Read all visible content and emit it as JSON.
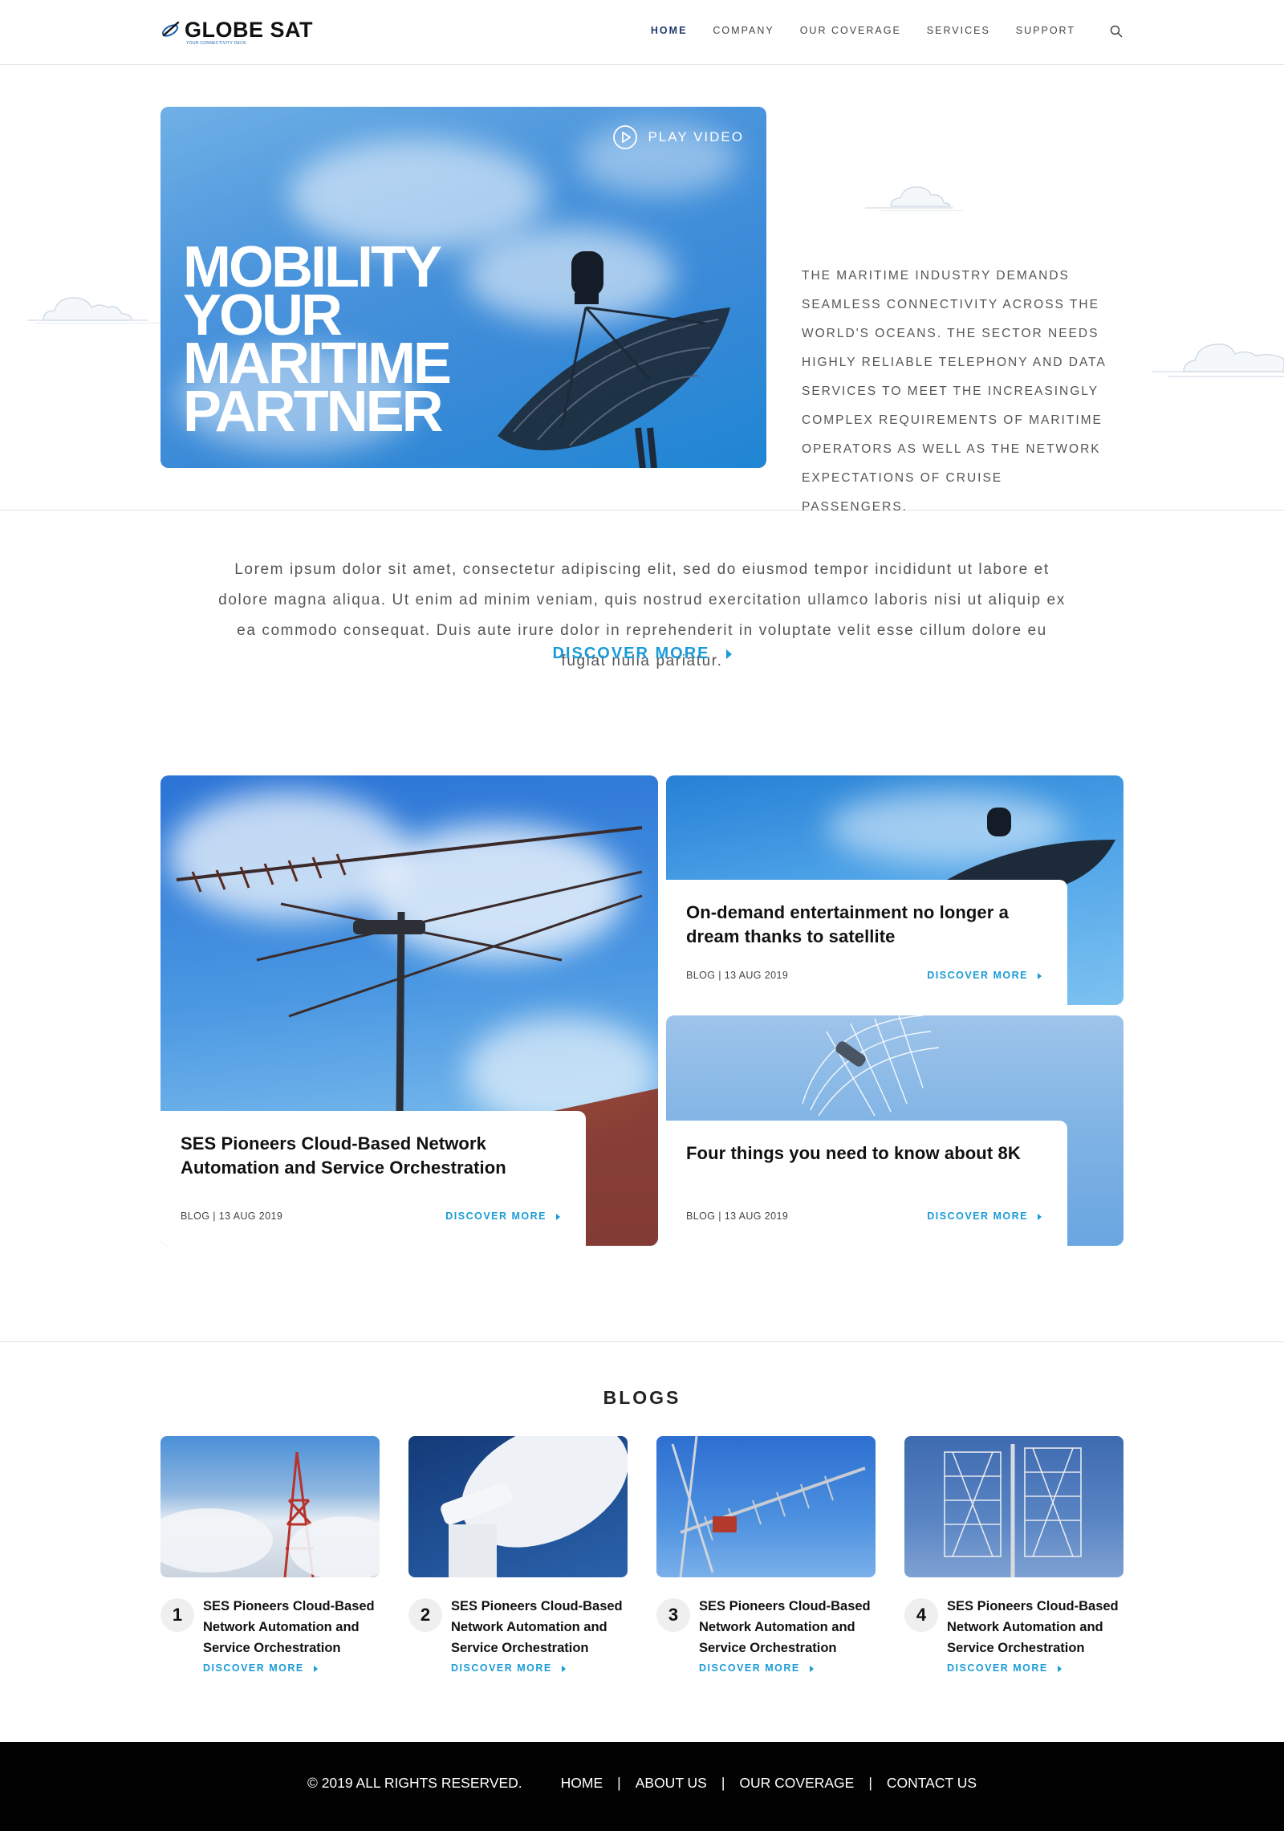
{
  "brand": {
    "name": "GLOBE SAT",
    "tagline": "YOUR CONNECTIVITY DECK"
  },
  "nav": {
    "items": [
      {
        "label": "HOME",
        "active": true
      },
      {
        "label": "COMPANY",
        "active": false
      },
      {
        "label": "OUR COVERAGE",
        "active": false
      },
      {
        "label": "SERVICES",
        "active": false
      },
      {
        "label": "SUPPORT",
        "active": false
      }
    ],
    "search_icon": "search-icon"
  },
  "hero": {
    "title_lines": [
      "MOBILITY",
      "YOUR",
      "MARITIME",
      "PARTNER"
    ],
    "play_label": "PLAY VIDEO",
    "play_icon": "play-circle-icon",
    "description": "THE MARITIME INDUSTRY DEMANDS SEAMLESS CONNECTIVITY ACROSS THE WORLD'S OCEANS. THE SECTOR NEEDS HIGHLY RELIABLE TELEPHONY AND DATA SERVICES TO MEET THE INCREASINGLY COMPLEX REQUIREMENTS OF MARITIME OPERATORS AS WELL AS THE NETWORK EXPECTATIONS OF CRUISE PASSENGERS."
  },
  "intro": {
    "text": "Lorem ipsum dolor sit amet, consectetur adipiscing elit, sed do eiusmod tempor incididunt ut labore et dolore magna aliqua. Ut enim ad minim veniam, quis nostrud exercitation ullamco laboris nisi ut aliquip ex ea commodo consequat. Duis aute irure dolor in reprehenderit in voluptate velit esse cillum dolore eu fugiat nulla pariatur.",
    "cta": "DISCOVER MORE"
  },
  "features": [
    {
      "title": "SES Pioneers Cloud-Based Network Automation and Service Orchestration",
      "meta": "BLOG | 13 AUG 2019",
      "link": "DISCOVER MORE"
    },
    {
      "title": "On-demand entertainment no longer a dream thanks to satellite",
      "meta": "BLOG | 13 AUG 2019",
      "link": "DISCOVER MORE"
    },
    {
      "title": "Four things you need to know about 8K",
      "meta": "BLOG | 13 AUG 2019",
      "link": "DISCOVER MORE"
    }
  ],
  "blogs": {
    "heading": "BLOGS",
    "items": [
      {
        "num": "1",
        "title": "SES Pioneers Cloud-Based Network Automation and Service Orchestration",
        "link": "DISCOVER MORE"
      },
      {
        "num": "2",
        "title": "SES Pioneers Cloud-Based Network Automation and Service Orchestration",
        "link": "DISCOVER MORE"
      },
      {
        "num": "3",
        "title": "SES Pioneers Cloud-Based Network Automation and Service Orchestration",
        "link": "DISCOVER MORE"
      },
      {
        "num": "4",
        "title": "SES Pioneers Cloud-Based Network Automation and Service Orchestration",
        "link": "DISCOVER MORE"
      }
    ]
  },
  "footer": {
    "copyright": "© 2019 ALL RIGHTS RESERVED.",
    "links": [
      "HOME",
      "ABOUT US",
      "OUR COVERAGE",
      "CONTACT US"
    ],
    "separator": "|"
  },
  "colors": {
    "accent": "#1a9bd7",
    "nav_active": "#1e3b6f",
    "footer_bg": "#020202",
    "text": "#555555"
  }
}
